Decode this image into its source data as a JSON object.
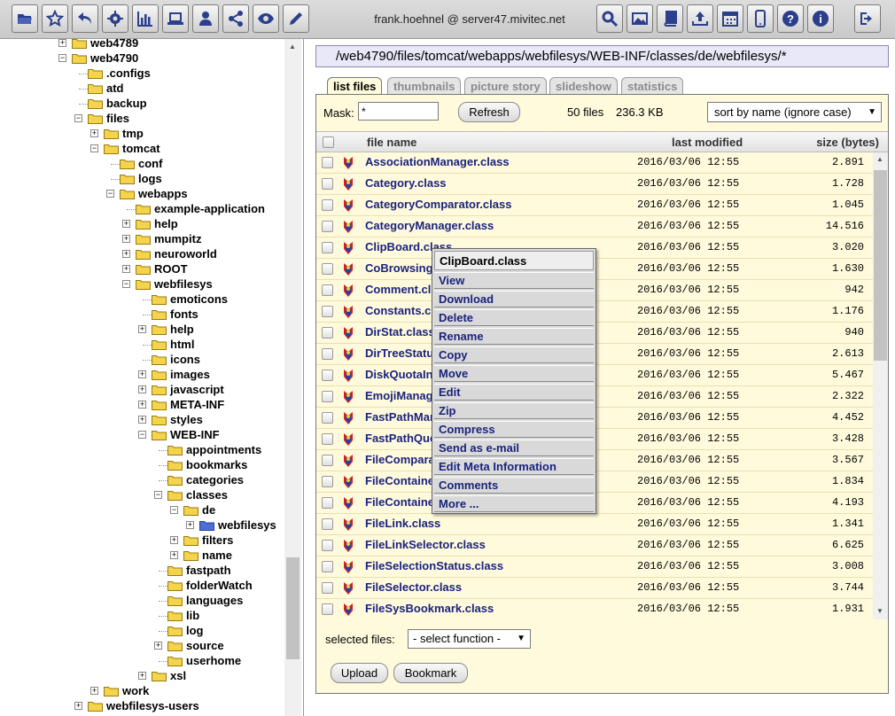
{
  "toolbar": {
    "user": "frank.hoehnel @ server47.mivitec.net",
    "left_icons": [
      "folder-open-icon",
      "star-icon",
      "undo-icon",
      "gear-icon",
      "bar-chart-icon",
      "laptop-icon",
      "user-icon",
      "share-icon",
      "eye-icon",
      "pencil-icon"
    ],
    "right_icons": [
      "search-icon",
      "image-icon",
      "book-icon",
      "upload-icon",
      "calendar-icon",
      "mobile-icon",
      "help-icon",
      "info-icon",
      "logout-icon"
    ]
  },
  "tree": {
    "nodes": [
      {
        "label": "web4789",
        "depth": 0,
        "expander": "+"
      },
      {
        "label": "web4790",
        "depth": 0,
        "expander": "-"
      },
      {
        "label": ".configs",
        "depth": 1,
        "expander": ""
      },
      {
        "label": "atd",
        "depth": 1,
        "expander": ""
      },
      {
        "label": "backup",
        "depth": 1,
        "expander": ""
      },
      {
        "label": "files",
        "depth": 1,
        "expander": "-"
      },
      {
        "label": "tmp",
        "depth": 2,
        "expander": "+"
      },
      {
        "label": "tomcat",
        "depth": 2,
        "expander": "-"
      },
      {
        "label": "conf",
        "depth": 3,
        "expander": ""
      },
      {
        "label": "logs",
        "depth": 3,
        "expander": ""
      },
      {
        "label": "webapps",
        "depth": 3,
        "expander": "-"
      },
      {
        "label": "example-application",
        "depth": 4,
        "expander": ""
      },
      {
        "label": "help",
        "depth": 4,
        "expander": "+"
      },
      {
        "label": "mumpitz",
        "depth": 4,
        "expander": "+"
      },
      {
        "label": "neuroworld",
        "depth": 4,
        "expander": "+"
      },
      {
        "label": "ROOT",
        "depth": 4,
        "expander": "+"
      },
      {
        "label": "webfilesys",
        "depth": 4,
        "expander": "-"
      },
      {
        "label": "emoticons",
        "depth": 5,
        "expander": ""
      },
      {
        "label": "fonts",
        "depth": 5,
        "expander": ""
      },
      {
        "label": "help",
        "depth": 5,
        "expander": "+"
      },
      {
        "label": "html",
        "depth": 5,
        "expander": ""
      },
      {
        "label": "icons",
        "depth": 5,
        "expander": ""
      },
      {
        "label": "images",
        "depth": 5,
        "expander": "+"
      },
      {
        "label": "javascript",
        "depth": 5,
        "expander": "+"
      },
      {
        "label": "META-INF",
        "depth": 5,
        "expander": "+"
      },
      {
        "label": "styles",
        "depth": 5,
        "expander": "+"
      },
      {
        "label": "WEB-INF",
        "depth": 5,
        "expander": "-"
      },
      {
        "label": "appointments",
        "depth": 6,
        "expander": ""
      },
      {
        "label": "bookmarks",
        "depth": 6,
        "expander": ""
      },
      {
        "label": "categories",
        "depth": 6,
        "expander": ""
      },
      {
        "label": "classes",
        "depth": 6,
        "expander": "-"
      },
      {
        "label": "de",
        "depth": 7,
        "expander": "-"
      },
      {
        "label": "webfilesys",
        "depth": 8,
        "expander": "+",
        "selected": true
      },
      {
        "label": "filters",
        "depth": 7,
        "expander": "+"
      },
      {
        "label": "name",
        "depth": 7,
        "expander": "+"
      },
      {
        "label": "fastpath",
        "depth": 6,
        "expander": ""
      },
      {
        "label": "folderWatch",
        "depth": 6,
        "expander": ""
      },
      {
        "label": "languages",
        "depth": 6,
        "expander": ""
      },
      {
        "label": "lib",
        "depth": 6,
        "expander": ""
      },
      {
        "label": "log",
        "depth": 6,
        "expander": ""
      },
      {
        "label": "source",
        "depth": 6,
        "expander": "+"
      },
      {
        "label": "userhome",
        "depth": 6,
        "expander": ""
      },
      {
        "label": "xsl",
        "depth": 5,
        "expander": "+"
      },
      {
        "label": "work",
        "depth": 2,
        "expander": "+"
      },
      {
        "label": "webfilesys-users",
        "depth": 1,
        "expander": "+"
      }
    ]
  },
  "path": "/web4790/files/tomcat/webapps/webfilesys/WEB-INF/classes/de/webfilesys/*",
  "tabs": [
    "list files",
    "thumbnails",
    "picture story",
    "slideshow",
    "statistics"
  ],
  "filter": {
    "mask_label": "Mask:",
    "mask_value": "*",
    "refresh_label": "Refresh",
    "file_count": "50 files",
    "total_size": "236.3 KB",
    "sort_value": "sort by name (ignore case)"
  },
  "columns": {
    "name": "file name",
    "modified": "last modified",
    "size": "size (bytes)"
  },
  "files": [
    {
      "name": "AssociationManager.class",
      "date": "2016/03/06 12:55",
      "size": "2.891"
    },
    {
      "name": "Category.class",
      "date": "2016/03/06 12:55",
      "size": "1.728"
    },
    {
      "name": "CategoryComparator.class",
      "date": "2016/03/06 12:55",
      "size": "1.045"
    },
    {
      "name": "CategoryManager.class",
      "date": "2016/03/06 12:55",
      "size": "14.516"
    },
    {
      "name": "ClipBoard.class",
      "date": "2016/03/06 12:55",
      "size": "3.020"
    },
    {
      "name": "CoBrowsing",
      "date": "2016/03/06 12:55",
      "size": "1.630"
    },
    {
      "name": "Comment.cl",
      "date": "2016/03/06 12:55",
      "size": "942"
    },
    {
      "name": "Constants.cl",
      "date": "2016/03/06 12:55",
      "size": "1.176"
    },
    {
      "name": "DirStat.class",
      "date": "2016/03/06 12:55",
      "size": "940"
    },
    {
      "name": "DirTreeStatu",
      "date": "2016/03/06 12:55",
      "size": "2.613"
    },
    {
      "name": "DiskQuotaIn",
      "date": "2016/03/06 12:55",
      "size": "5.467"
    },
    {
      "name": "EmojiManag",
      "date": "2016/03/06 12:55",
      "size": "2.322"
    },
    {
      "name": "FastPathMar",
      "date": "2016/03/06 12:55",
      "size": "4.452"
    },
    {
      "name": "FastPathQue",
      "date": "2016/03/06 12:55",
      "size": "3.428"
    },
    {
      "name": "FileCompara",
      "date": "2016/03/06 12:55",
      "size": "3.567"
    },
    {
      "name": "FileContaine",
      "date": "2016/03/06 12:55",
      "size": "1.834"
    },
    {
      "name": "FileContaine",
      "date": "2016/03/06 12:55",
      "size": "4.193"
    },
    {
      "name": "FileLink.class",
      "date": "2016/03/06 12:55",
      "size": "1.341"
    },
    {
      "name": "FileLinkSelector.class",
      "date": "2016/03/06 12:55",
      "size": "6.625"
    },
    {
      "name": "FileSelectionStatus.class",
      "date": "2016/03/06 12:55",
      "size": "3.008"
    },
    {
      "name": "FileSelector.class",
      "date": "2016/03/06 12:55",
      "size": "3.744"
    },
    {
      "name": "FileSysBookmark.class",
      "date": "2016/03/06 12:55",
      "size": "1.931"
    }
  ],
  "bottom": {
    "selected_label": "selected files:",
    "function_value": "- select function -",
    "upload_label": "Upload",
    "bookmark_label": "Bookmark"
  },
  "context_menu": {
    "title": "ClipBoard.class",
    "items": [
      "View",
      "Download",
      "Delete",
      "Rename",
      "Copy",
      "Move",
      "Edit",
      "Zip",
      "Compress",
      "Send as e-mail",
      "Edit Meta Information",
      "Comments",
      "More ..."
    ]
  }
}
